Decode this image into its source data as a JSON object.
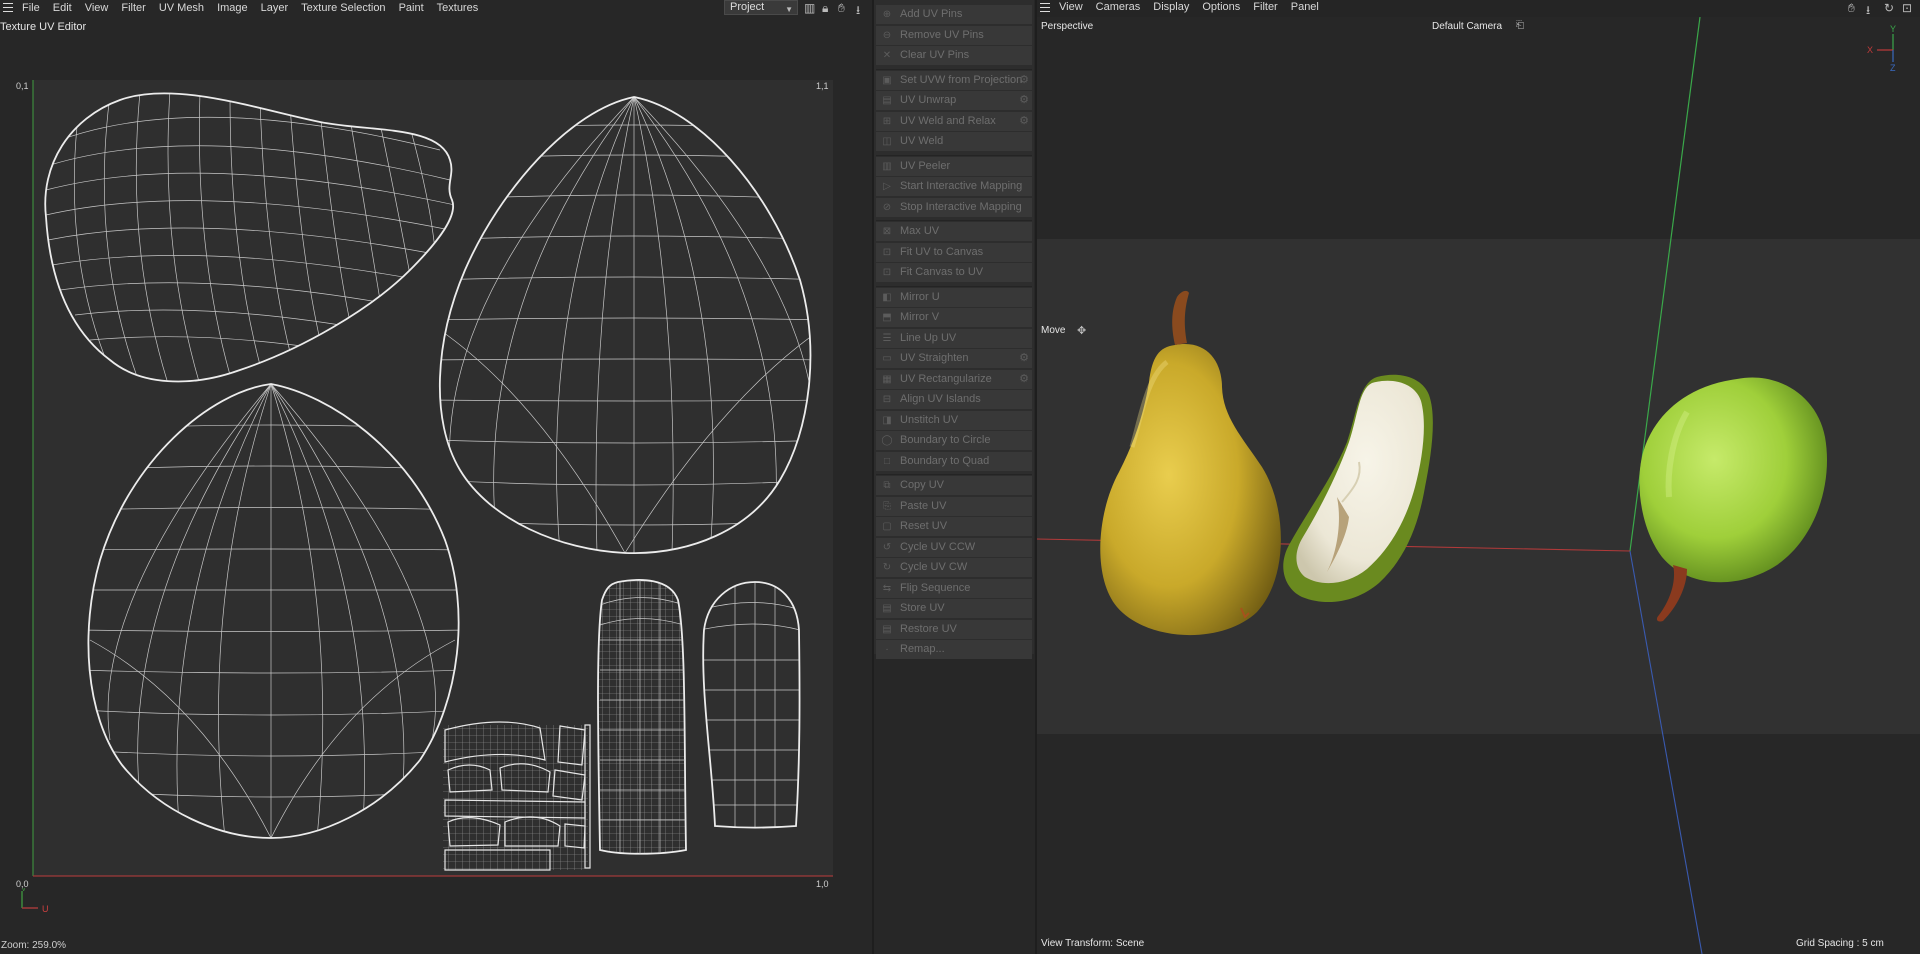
{
  "uv_editor": {
    "menu": [
      "File",
      "Edit",
      "View",
      "Filter",
      "UV Mesh",
      "Image",
      "Layer",
      "Texture Selection",
      "Paint",
      "Textures"
    ],
    "title": "Texture UV Editor",
    "project_select": "Project",
    "coords": {
      "top_left": "0,1",
      "top_right": "1,1",
      "bottom_left": "0,0",
      "bottom_right": "1,0"
    },
    "axis_u": "U",
    "axis_v": "V",
    "zoom": "Zoom: 259.0%"
  },
  "uv_tools": {
    "groups": [
      [
        {
          "label": "Add UV Pins",
          "icon": "pin-icon",
          "glyph": "⊕"
        },
        {
          "label": "Remove UV Pins",
          "icon": "pin-remove-icon",
          "glyph": "⊖"
        },
        {
          "label": "Clear UV Pins",
          "icon": "clear-icon",
          "glyph": "✕"
        }
      ],
      [
        {
          "label": "Set UVW from Projection",
          "icon": "projection-icon",
          "glyph": "▣",
          "gear": true
        },
        {
          "label": "UV Unwrap",
          "icon": "unwrap-icon",
          "glyph": "▤",
          "gear": true
        },
        {
          "label": "UV Weld and Relax",
          "icon": "weld-relax-icon",
          "glyph": "⊞",
          "gear": true
        },
        {
          "label": "UV Weld",
          "icon": "weld-icon",
          "glyph": "◫"
        }
      ],
      [
        {
          "label": "UV Peeler",
          "icon": "peeler-icon",
          "glyph": "▥"
        },
        {
          "label": "Start Interactive Mapping",
          "icon": "play-icon",
          "glyph": "▷"
        },
        {
          "label": "Stop Interactive Mapping",
          "icon": "stop-icon",
          "glyph": "⊘"
        }
      ],
      [
        {
          "label": "Max UV",
          "icon": "max-uv-icon",
          "glyph": "⊠"
        },
        {
          "label": "Fit UV to Canvas",
          "icon": "fit-uv-icon",
          "glyph": "⊡"
        },
        {
          "label": "Fit Canvas to UV",
          "icon": "fit-canvas-icon",
          "glyph": "⊡"
        }
      ],
      [
        {
          "label": "Mirror U",
          "icon": "mirror-u-icon",
          "glyph": "◧"
        },
        {
          "label": "Mirror V",
          "icon": "mirror-v-icon",
          "glyph": "⬒"
        },
        {
          "label": "Line Up UV",
          "icon": "line-up-icon",
          "glyph": "☰"
        },
        {
          "label": "UV Straighten",
          "icon": "straighten-icon",
          "glyph": "▭",
          "gear": true
        },
        {
          "label": "UV Rectangularize",
          "icon": "rectangularize-icon",
          "glyph": "▦",
          "gear": true
        },
        {
          "label": "Align UV Islands",
          "icon": "align-icon",
          "glyph": "⊟"
        },
        {
          "label": "Unstitch UV",
          "icon": "unstitch-icon",
          "glyph": "◨"
        },
        {
          "label": "Boundary to Circle",
          "icon": "circle-icon",
          "glyph": "◯"
        },
        {
          "label": "Boundary to Quad",
          "icon": "quad-icon",
          "glyph": "□"
        }
      ],
      [
        {
          "label": "Copy UV",
          "icon": "copy-icon",
          "glyph": "⧉"
        },
        {
          "label": "Paste UV",
          "icon": "paste-icon",
          "glyph": "⎘"
        },
        {
          "label": "Reset UV",
          "icon": "reset-icon",
          "glyph": "▢"
        },
        {
          "label": "Cycle UV CCW",
          "icon": "cycle-ccw-icon",
          "glyph": "↺"
        },
        {
          "label": "Cycle UV CW",
          "icon": "cycle-cw-icon",
          "glyph": "↻"
        },
        {
          "label": "Flip Sequence",
          "icon": "flip-icon",
          "glyph": "⇆"
        },
        {
          "label": "Store UV",
          "icon": "store-icon",
          "glyph": "▤"
        },
        {
          "label": "Restore UV",
          "icon": "restore-icon",
          "glyph": "▤"
        },
        {
          "label": "Remap...",
          "icon": "remap-icon",
          "glyph": "·"
        }
      ]
    ]
  },
  "viewport": {
    "menu": [
      "View",
      "Cameras",
      "Display",
      "Options",
      "Filter",
      "Panel"
    ],
    "projection": "Perspective",
    "camera": "Default Camera",
    "tool": "Move",
    "view_transform": "View Transform: Scene",
    "grid_spacing": "Grid Spacing : 5 cm",
    "gizmo": {
      "x": "X",
      "y": "Y",
      "z": "Z"
    },
    "colors": {
      "yellow_pear": "#c9a92a",
      "green_pear": "#9fcf3a",
      "pear_flesh": "#ece7d6",
      "stem": "#8a4a1e"
    }
  }
}
